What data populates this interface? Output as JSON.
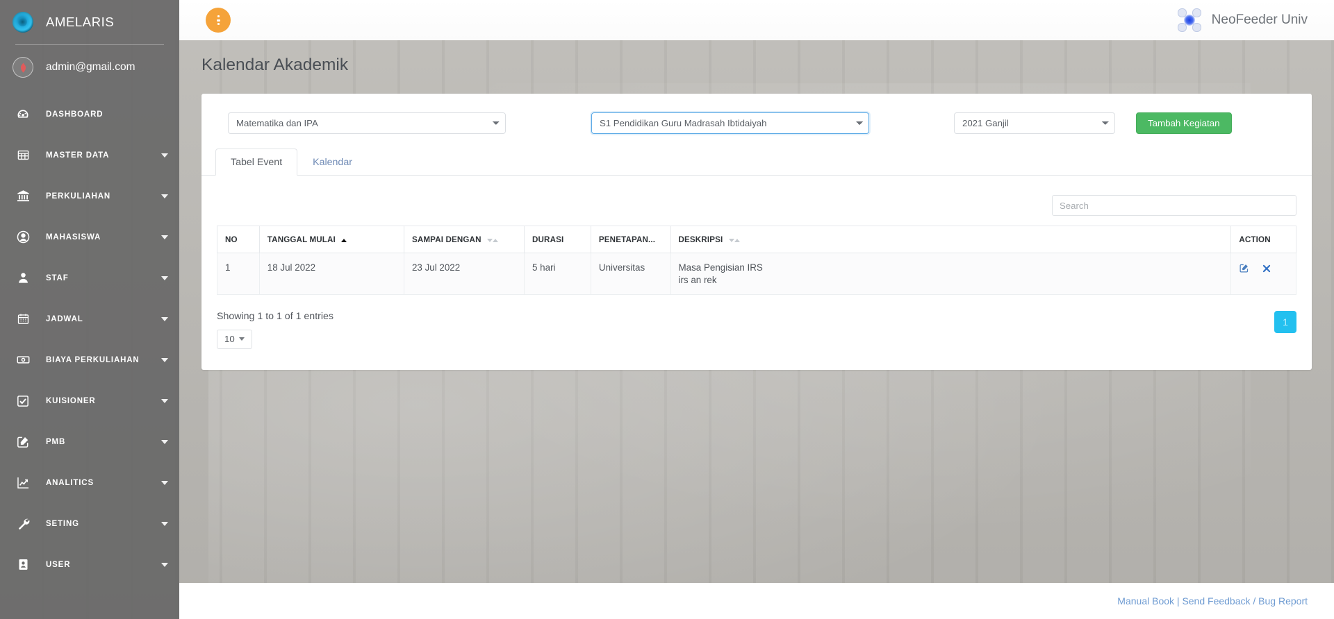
{
  "sidebar": {
    "brand": {
      "name": "AMELARIS",
      "logo_icon": "amelaris-logo-icon"
    },
    "user": {
      "email": "admin@gmail.com",
      "avatar_icon": "user-avatar-icon"
    },
    "items": [
      {
        "label": "DASHBOARD",
        "icon": "dashboard-icon",
        "has_caret": false
      },
      {
        "label": "MASTER DATA",
        "icon": "table-grid-icon",
        "has_caret": true
      },
      {
        "label": "PERKULIAHAN",
        "icon": "bank-columns-icon",
        "has_caret": true
      },
      {
        "label": "MAHASISWA",
        "icon": "user-circle-icon",
        "has_caret": true
      },
      {
        "label": "STAF",
        "icon": "person-icon",
        "has_caret": true
      },
      {
        "label": "JADWAL",
        "icon": "calendar-icon",
        "has_caret": true
      },
      {
        "label": "BIAYA PERKULIAHAN",
        "icon": "money-bill-icon",
        "has_caret": true
      },
      {
        "label": "KUISIONER",
        "icon": "check-square-icon",
        "has_caret": true
      },
      {
        "label": "PMB",
        "icon": "pencil-square-icon",
        "has_caret": true
      },
      {
        "label": "ANALITICS",
        "icon": "chart-line-up-icon",
        "has_caret": true
      },
      {
        "label": "SETING",
        "icon": "wrench-icon",
        "has_caret": true
      },
      {
        "label": "USER",
        "icon": "id-badge-icon",
        "has_caret": true
      }
    ]
  },
  "topbar": {
    "menu_button_icon": "vertical-dots-menu-icon",
    "app_logo_icon": "neofeeder-logo-icon",
    "app_title": "NeoFeeder Univ"
  },
  "page": {
    "title": "Kalendar Akademik"
  },
  "filters": {
    "fakultas_value": "Matematika dan IPA",
    "prodi_value": "S1 Pendidikan Guru Madrasah Ibtidaiyah",
    "semester_value": "2021 Ganjil",
    "add_button_label": "Tambah Kegiatan"
  },
  "tabs": [
    {
      "label": "Tabel Event",
      "active": true
    },
    {
      "label": "Kalendar",
      "active": false
    }
  ],
  "search": {
    "placeholder": "Search",
    "value": ""
  },
  "table": {
    "columns": [
      {
        "label": "NO",
        "sort": "none"
      },
      {
        "label": "TANGGAL MULAI",
        "sort": "asc"
      },
      {
        "label": "SAMPAI DENGAN",
        "sort": "both"
      },
      {
        "label": "DURASI",
        "sort": "none"
      },
      {
        "label": "PENETAPAN...",
        "sort": "none"
      },
      {
        "label": "DESKRIPSI",
        "sort": "both"
      },
      {
        "label": "ACTION",
        "sort": "none"
      }
    ],
    "rows": [
      {
        "no": "1",
        "tanggal_mulai": "18 Jul 2022",
        "sampai_dengan": "23 Jul 2022",
        "durasi": "5 hari",
        "penetapan": "Universitas",
        "deskripsi_line1": "Masa Pengisian IRS",
        "deskripsi_line2": "irs an rek",
        "edit_icon": "edit-pencil-square-icon",
        "delete_icon": "delete-x-icon"
      }
    ]
  },
  "pagination": {
    "entries_info": "Showing 1 to 1 of 1 entries",
    "page_length": "10",
    "pages": [
      "1"
    ],
    "active_page": "1"
  },
  "footer": {
    "manual_book": "Manual Book",
    "separator": " | ",
    "feedback": "Send Feedback / Bug Report"
  },
  "colors": {
    "accent_orange": "#f5a33a",
    "accent_green": "#4cb963",
    "accent_cyan": "#23c0ef",
    "link_blue": "#6e9bd2",
    "sidebar_gray": "#646464"
  }
}
